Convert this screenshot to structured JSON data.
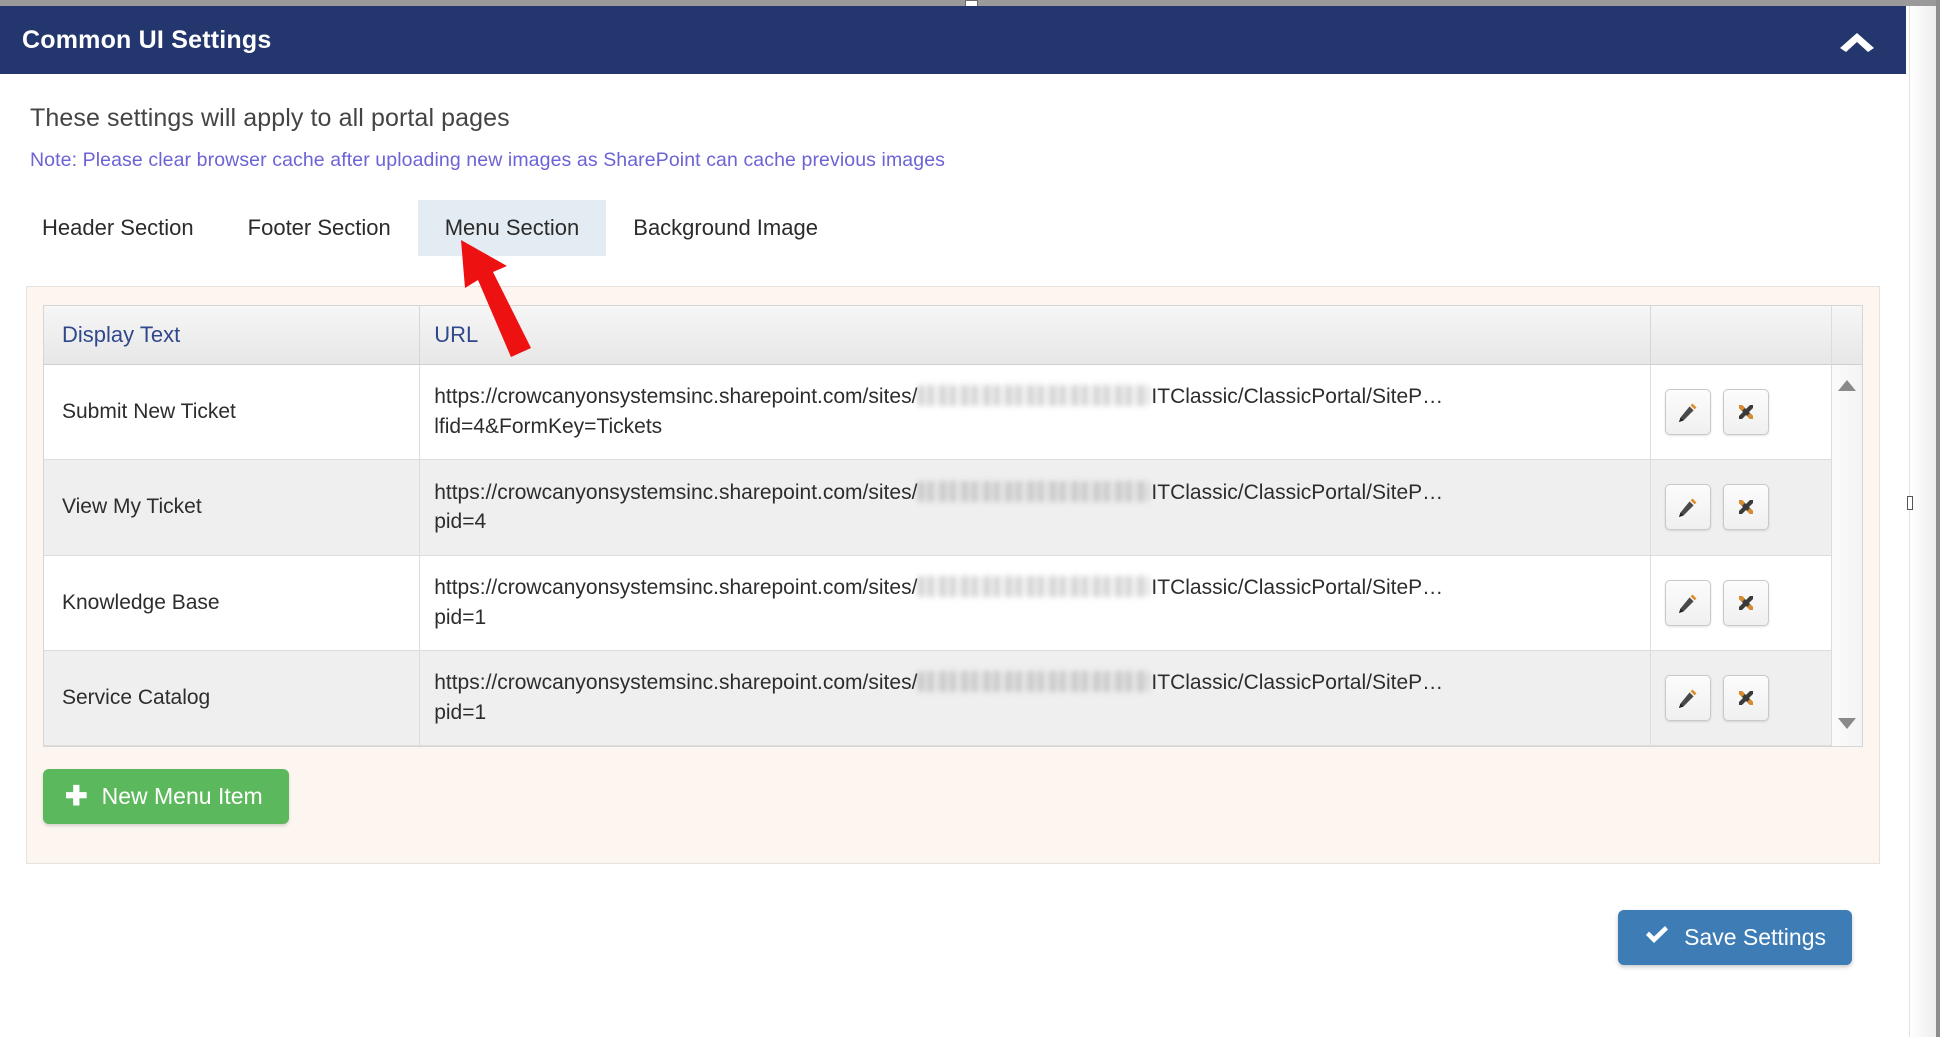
{
  "window": {
    "title": "Common UI Settings",
    "collapse_icon": "chevron-up-icon",
    "accent_header_color": "#23366d"
  },
  "intro": {
    "description": "These settings will apply to all portal pages",
    "note": "Note: Please clear browser cache after uploading new images as SharePoint can cache previous images",
    "note_color": "#6b63d6"
  },
  "tabs": [
    {
      "label": "Header Section",
      "active": false
    },
    {
      "label": "Footer Section",
      "active": false
    },
    {
      "label": "Menu Section",
      "active": true
    },
    {
      "label": "Background Image",
      "active": false
    }
  ],
  "grid": {
    "columns": [
      "Display Text",
      "URL",
      ""
    ],
    "rows": [
      {
        "display_text": "Submit New Ticket",
        "url_prefix": "https://crowcanyonsystemsinc.sharepoint.com/sites/",
        "url_redacted": true,
        "url_suffix": "ITClassic/ClassicPortal/SiteP…",
        "url_line2": "lfid=4&FormKey=Tickets",
        "edit_label": "edit-icon",
        "delete_label": "delete-icon"
      },
      {
        "display_text": "View My Ticket",
        "url_prefix": "https://crowcanyonsystemsinc.sharepoint.com/sites/",
        "url_redacted": true,
        "url_suffix": "ITClassic/ClassicPortal/SiteP…",
        "url_line2": "pid=4",
        "edit_label": "edit-icon",
        "delete_label": "delete-icon"
      },
      {
        "display_text": "Knowledge Base",
        "url_prefix": "https://crowcanyonsystemsinc.sharepoint.com/sites/",
        "url_redacted": true,
        "url_suffix": "ITClassic/ClassicPortal/SiteP…",
        "url_line2": "pid=1",
        "edit_label": "edit-icon",
        "delete_label": "delete-icon"
      },
      {
        "display_text": "Service Catalog",
        "url_prefix": "https://crowcanyonsystemsinc.sharepoint.com/sites/",
        "url_redacted": true,
        "url_suffix": "ITClassic/ClassicPortal/SiteP…",
        "url_line2": "pid=1",
        "edit_label": "edit-icon",
        "delete_label": "delete-icon"
      }
    ],
    "scrollbar": {
      "up_arrow": "scroll-up-arrow",
      "down_arrow": "scroll-down-arrow"
    }
  },
  "buttons": {
    "new_menu_item": "New Menu Item",
    "new_menu_item_icon": "plus-icon",
    "new_menu_item_color": "#5cb85c",
    "save_settings": "Save Settings",
    "save_settings_icon": "check-icon",
    "save_settings_color": "#3d7cb5"
  },
  "annotation": {
    "type": "arrow",
    "color": "#ee1111",
    "points_to": "Menu Section"
  }
}
